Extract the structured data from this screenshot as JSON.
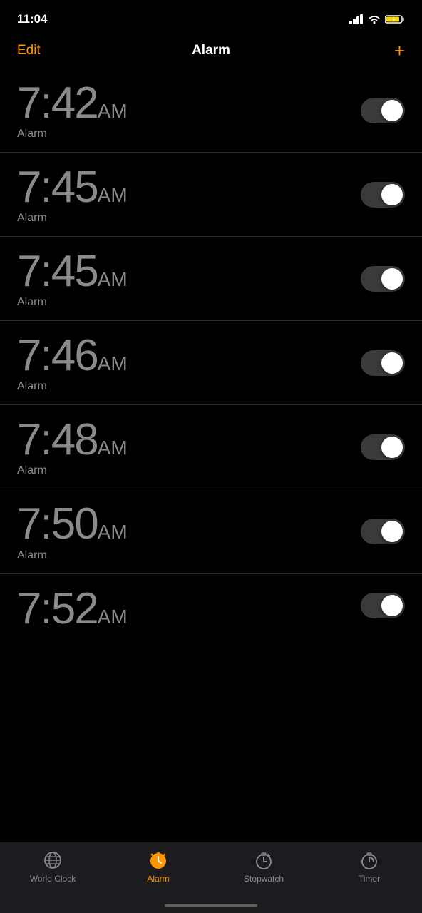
{
  "statusBar": {
    "time": "11:04"
  },
  "header": {
    "editLabel": "Edit",
    "title": "Alarm",
    "addLabel": "+"
  },
  "alarms": [
    {
      "time": "7:42",
      "ampm": "AM",
      "label": "Alarm",
      "enabled": false
    },
    {
      "time": "7:45",
      "ampm": "AM",
      "label": "Alarm",
      "enabled": false
    },
    {
      "time": "7:45",
      "ampm": "AM",
      "label": "Alarm",
      "enabled": false
    },
    {
      "time": "7:46",
      "ampm": "AM",
      "label": "Alarm",
      "enabled": false
    },
    {
      "time": "7:48",
      "ampm": "AM",
      "label": "Alarm",
      "enabled": false
    },
    {
      "time": "7:50",
      "ampm": "AM",
      "label": "Alarm",
      "enabled": false
    }
  ],
  "partialAlarm": {
    "time": "7:52",
    "ampm": "AM"
  },
  "tabs": [
    {
      "id": "world-clock",
      "label": "World Clock",
      "active": false
    },
    {
      "id": "alarm",
      "label": "Alarm",
      "active": true
    },
    {
      "id": "stopwatch",
      "label": "Stopwatch",
      "active": false
    },
    {
      "id": "timer",
      "label": "Timer",
      "active": false
    }
  ]
}
